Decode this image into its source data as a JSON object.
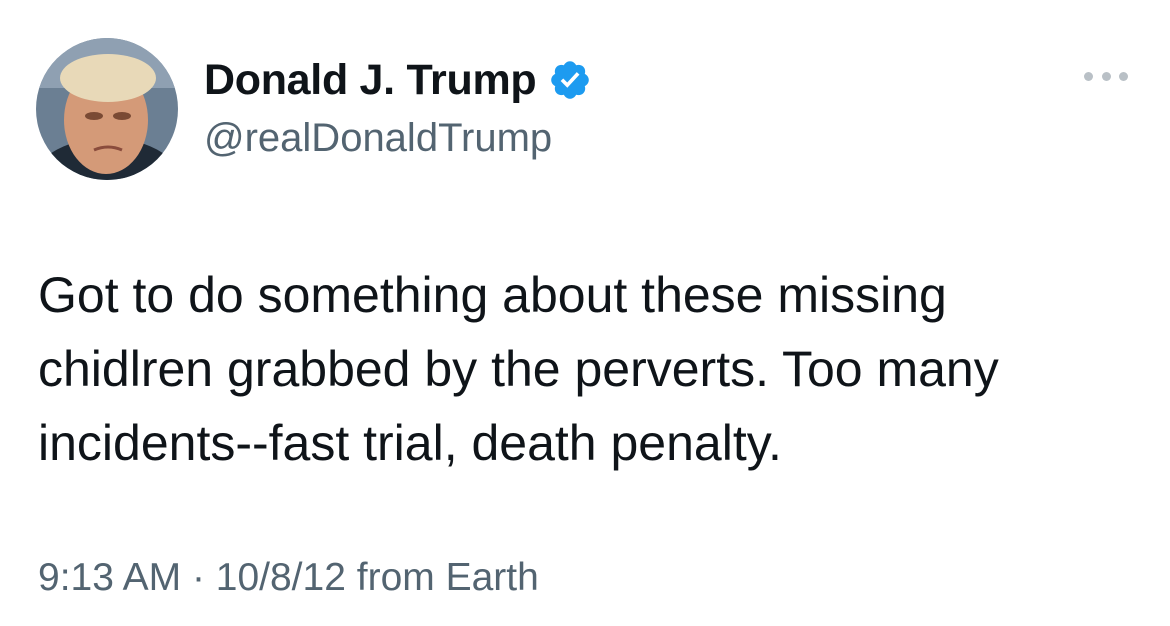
{
  "author": {
    "display_name": "Donald J. Trump",
    "handle": "@realDonaldTrump",
    "verified": true,
    "avatar_icon": "profile-photo"
  },
  "tweet": {
    "text": "Got to do something about these missing\nchidlren grabbed by the perverts. Too many\nincidents--fast trial, death penalty."
  },
  "meta": {
    "time": "9:13 AM",
    "separator": "·",
    "date": "10/8/12",
    "source": "from Earth"
  },
  "icons": {
    "verified": "verified-badge-icon",
    "more": "more-options-icon"
  },
  "colors": {
    "verified_blue": "#1d9bf0",
    "secondary_text": "#536471",
    "primary_text": "#0f1419"
  }
}
